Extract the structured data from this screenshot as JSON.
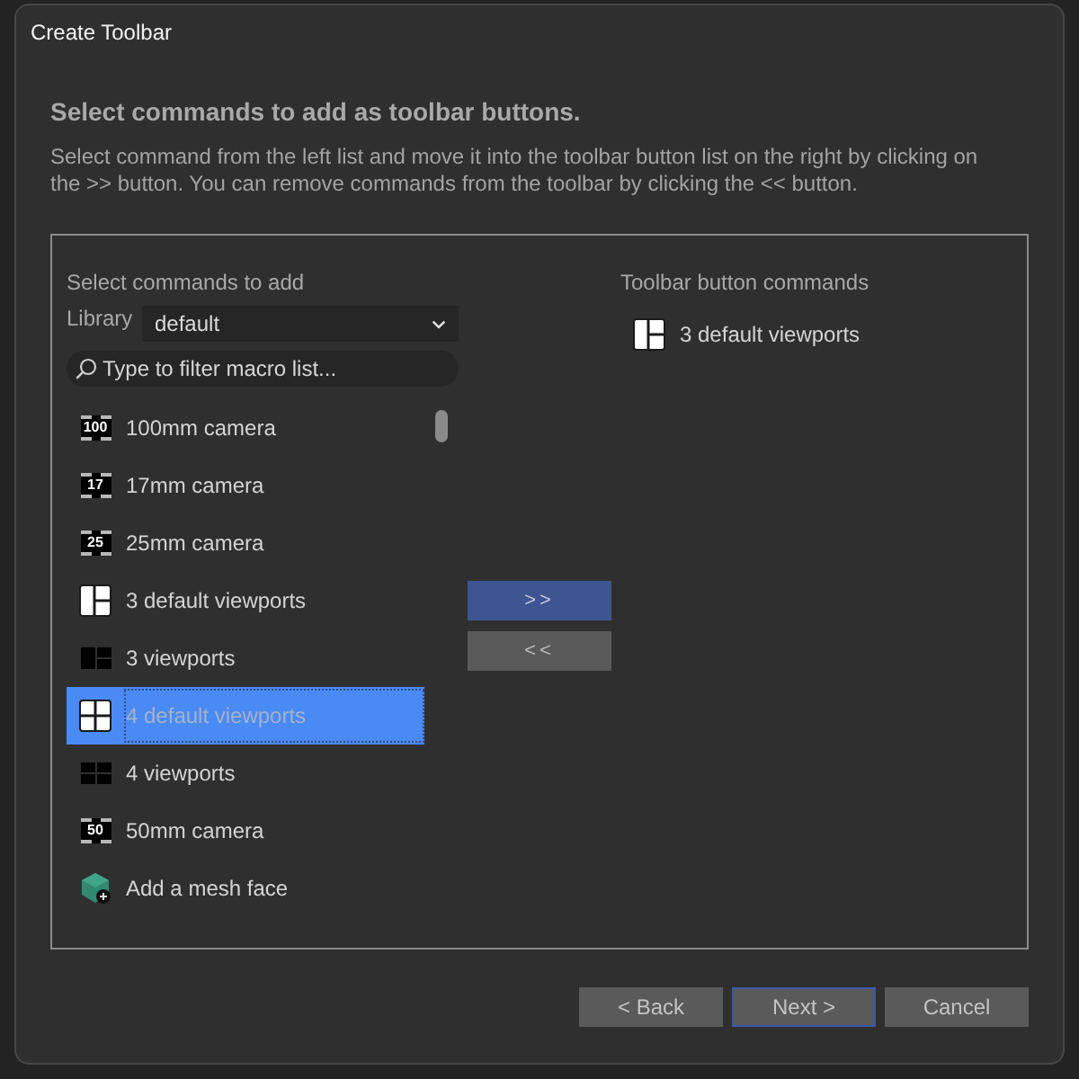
{
  "window": {
    "title": "Create Toolbar"
  },
  "heading": "Select commands to add as toolbar buttons.",
  "description": "Select command from the left list and move it into the toolbar button list on the right by clicking on the >> button. You can remove commands from the toolbar by clicking the << button.",
  "command_list": {
    "label": "Select commands to add",
    "library": {
      "label": "Library",
      "value": "default"
    },
    "filter": {
      "placeholder": "Type to filter macro list..."
    },
    "items": [
      {
        "kind": "camera",
        "badge": "100",
        "label": "100mm camera",
        "selected": false
      },
      {
        "kind": "camera",
        "badge": "17",
        "label": "17mm camera",
        "selected": false
      },
      {
        "kind": "camera",
        "badge": "25",
        "label": "25mm camera",
        "selected": false
      },
      {
        "kind": "three-pane-light",
        "label": "3 default viewports",
        "selected": false
      },
      {
        "kind": "three-pane-dark",
        "label": "3 viewports",
        "selected": false
      },
      {
        "kind": "four-pane-light",
        "label": "4 default viewports",
        "selected": true
      },
      {
        "kind": "four-pane-dark",
        "label": "4 viewports",
        "selected": false
      },
      {
        "kind": "camera",
        "badge": "50",
        "label": "50mm camera",
        "selected": false
      },
      {
        "kind": "mesh",
        "label": "Add a mesh face",
        "selected": false
      }
    ]
  },
  "move_buttons": [
    {
      "label": ">>",
      "highlighted": true
    },
    {
      "label": "<<",
      "highlighted": false
    }
  ],
  "toolbar_list": {
    "label": "Toolbar button commands",
    "items": [
      {
        "kind": "three-pane-light",
        "label": "3 default viewports"
      }
    ]
  },
  "footer_buttons": [
    {
      "label": "< Back",
      "focused": false
    },
    {
      "label": "Next >",
      "focused": true
    },
    {
      "label": "Cancel",
      "focused": false
    }
  ]
}
